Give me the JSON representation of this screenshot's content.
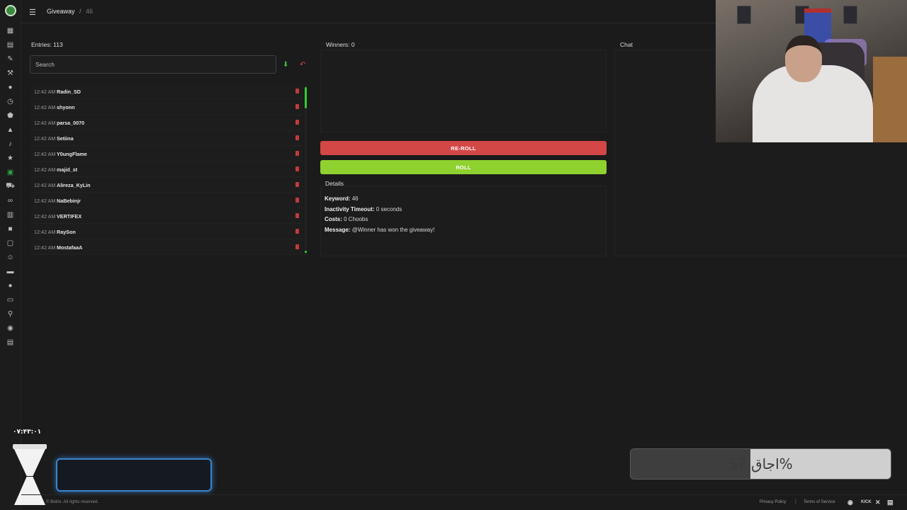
{
  "breadcrumb": {
    "page": "Giveaway",
    "separator": "/",
    "keyword": "46"
  },
  "entries": {
    "title": "Entries: 113",
    "search_placeholder": "Search",
    "items": [
      {
        "time": "12:42 AM",
        "name": "Radin_SD"
      },
      {
        "time": "12:42 AM",
        "name": "shyonn"
      },
      {
        "time": "12:42 AM",
        "name": "parsa_0070"
      },
      {
        "time": "12:42 AM",
        "name": "Setiina"
      },
      {
        "time": "12:42 AM",
        "name": "Y0ungFlame"
      },
      {
        "time": "12:42 AM",
        "name": "majid_st"
      },
      {
        "time": "12:42 AM",
        "name": "Alireza_KyLin"
      },
      {
        "time": "12:42 AM",
        "name": "NaBebinjr"
      },
      {
        "time": "12:42 AM",
        "name": "VERTIFEX"
      },
      {
        "time": "12:42 AM",
        "name": "RaySon"
      },
      {
        "time": "12:42 AM",
        "name": "MostafaaA"
      }
    ]
  },
  "winners": {
    "title": "Winners: 0"
  },
  "buttons": {
    "reroll": "RE-ROLL",
    "roll": "ROLL"
  },
  "details": {
    "title": "Details",
    "keyword_label": "Keyword:",
    "keyword_value": "46",
    "timeout_label": "Inactivity Timeout:",
    "timeout_value": "0 seconds",
    "costs_label": "Costs:",
    "costs_value": "0 Choobs",
    "message_label": "Message:",
    "message_value": "@Winner has won the giveaway!"
  },
  "chat": {
    "title": "Chat"
  },
  "overlay": {
    "clock": "۰۷:۴۳:۰۱",
    "progress_text": "اجاق 57%",
    "progress_percent": 57
  },
  "footer": {
    "copyright": "© Botrix. All rights reserved.",
    "privacy": "Privacy Policy",
    "separator": "|",
    "terms": "Terms of Service",
    "kick": "KICK"
  },
  "colors": {
    "reroll": "#d34747",
    "roll": "#8fd12e",
    "accent": "#2ea043"
  }
}
